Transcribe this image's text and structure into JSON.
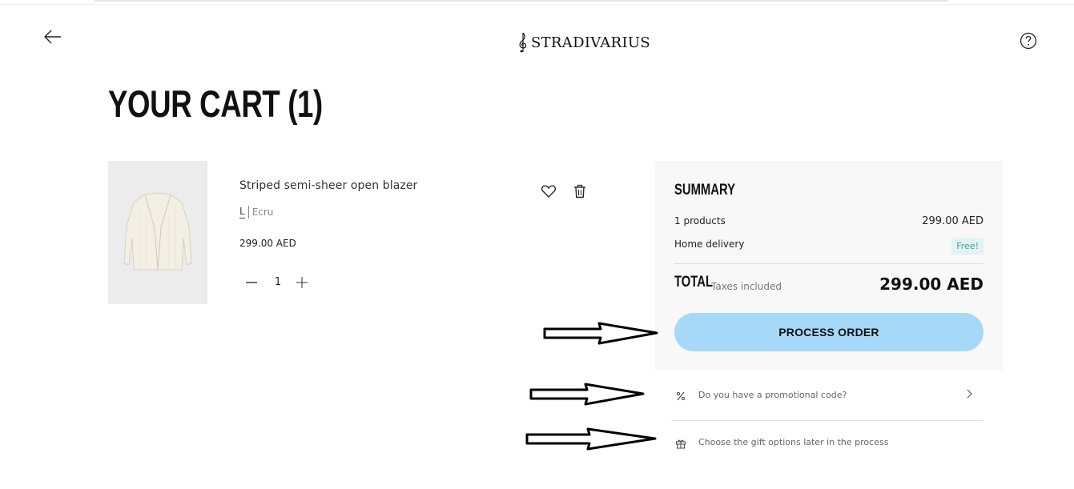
{
  "header": {
    "brand": "STRADIVARIUS",
    "back_icon": "arrow-left-icon",
    "help_icon": "question-circle-icon"
  },
  "cart": {
    "title": "YOUR CART (1)",
    "item": {
      "name": "Striped semi-sheer open blazer",
      "size": "L",
      "color": "Ecru",
      "price": "299.00 AED",
      "quantity": "1"
    }
  },
  "summary": {
    "title": "SUMMARY",
    "products_label": "1 products",
    "products_value": "299.00 AED",
    "delivery_label": "Home delivery",
    "delivery_value": "Free!",
    "total_label": "TOTAL",
    "taxes_note": "Taxes included",
    "total_value": "299.00 AED",
    "process_button": "PROCESS ORDER"
  },
  "options": {
    "promo_text": "Do you have a promotional code?",
    "gift_text": "Choose the gift options later in the process"
  },
  "colors": {
    "accent_button": "#a6d8f8",
    "summary_bg": "#f8f8f8",
    "free_badge_bg": "#e2f3f1",
    "free_badge_text": "#3aa89b"
  }
}
